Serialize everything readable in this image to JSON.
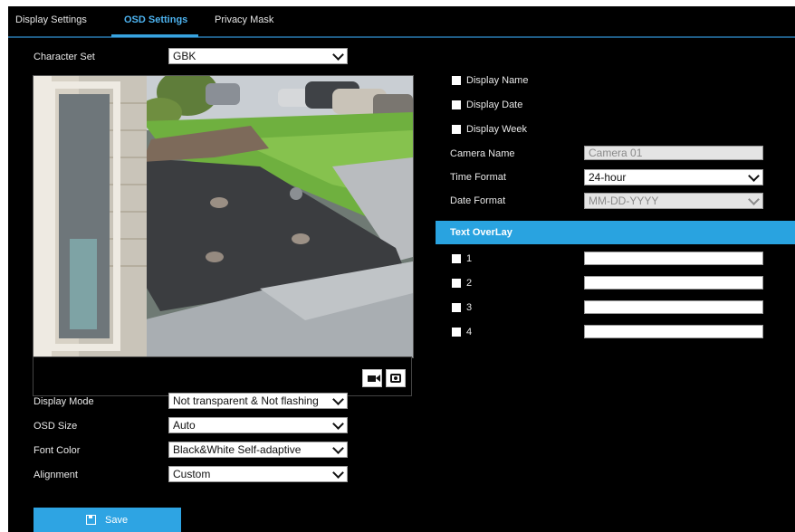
{
  "tabs": [
    {
      "label": "Display Settings"
    },
    {
      "label": "OSD Settings"
    },
    {
      "label": "Privacy Mask"
    }
  ],
  "active_tab": "OSD Settings",
  "character_set": {
    "label": "Character Set",
    "value": "GBK"
  },
  "display_options": [
    {
      "label": "Display Name",
      "checked": true
    },
    {
      "label": "Display Date",
      "checked": true
    },
    {
      "label": "Display Week",
      "checked": true
    }
  ],
  "camera_name": {
    "label": "Camera Name",
    "value": "Camera 01"
  },
  "time_format": {
    "label": "Time Format",
    "value": "24-hour"
  },
  "date_format": {
    "label": "Date Format",
    "value": "MM-DD-YYYY"
  },
  "text_overlay": {
    "title": "Text OverLay",
    "items": [
      {
        "label": "1",
        "value": ""
      },
      {
        "label": "2",
        "value": ""
      },
      {
        "label": "3",
        "value": ""
      },
      {
        "label": "4",
        "value": ""
      }
    ]
  },
  "display_mode": {
    "label": "Display Mode",
    "value": "Not transparent & Not flashing"
  },
  "osd_size": {
    "label": "OSD Size",
    "value": "Auto"
  },
  "font_color": {
    "label": "Font Color",
    "value": "Black&White Self-adaptive"
  },
  "alignment": {
    "label": "Alignment",
    "value": "Custom"
  },
  "save_button": {
    "label": "Save"
  },
  "colors": {
    "accent": "#29a3e0",
    "background": "#000000",
    "tab_active": "#4db3f0"
  },
  "icons": [
    "record-icon",
    "snapshot-icon",
    "save-icon",
    "chevron-down-icon"
  ]
}
